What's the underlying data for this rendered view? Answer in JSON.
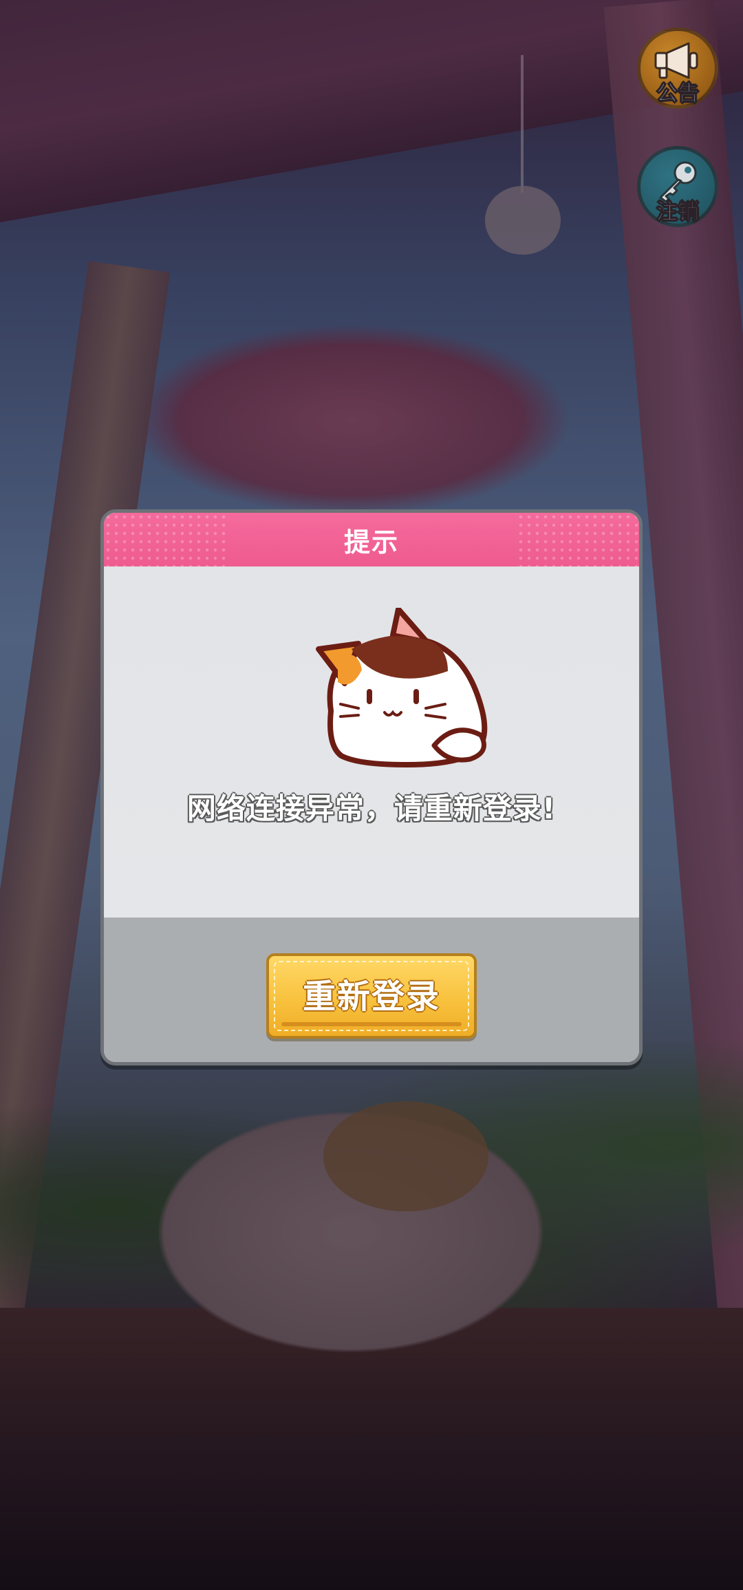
{
  "side_buttons": {
    "announcement_label": "公告",
    "logout_label": "注销"
  },
  "dialog": {
    "title": "提示",
    "message": "网络连接异常，请重新登录!",
    "relogin_label": "重新登录",
    "mascot_icon": "calico-cat-icon"
  },
  "colors": {
    "header_pink": "#f56a9c",
    "button_gold": "#f8c23e",
    "announce_orange": "#c8872a",
    "logout_teal": "#2f7282"
  }
}
